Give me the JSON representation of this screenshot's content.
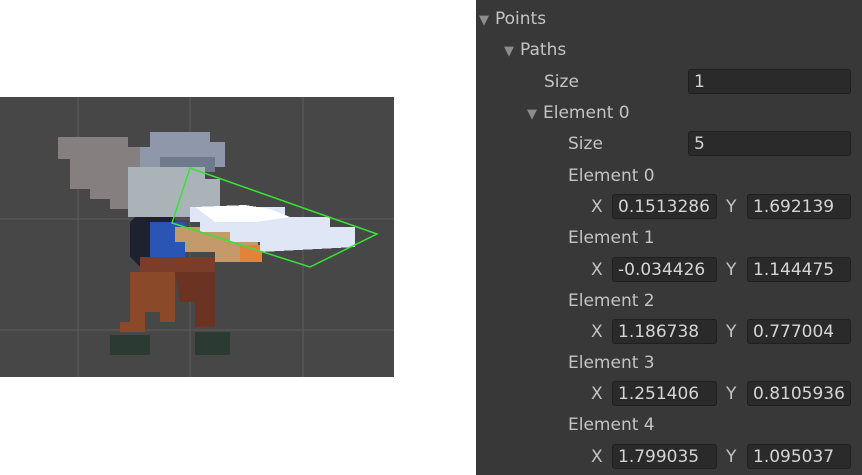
{
  "scene": {
    "background": "#474747",
    "grid_color": "#5c5c5c",
    "collider_color": "#37e337"
  },
  "inspector": {
    "points_label": "Points",
    "paths_label": "Paths",
    "paths_size_label": "Size",
    "paths_size_value": "1",
    "path_element_label": "Element 0",
    "points_size_label": "Size",
    "points_size_value": "5",
    "x_label": "X",
    "y_label": "Y",
    "elements": [
      {
        "label": "Element 0",
        "x": "0.1513286",
        "y": "1.692139"
      },
      {
        "label": "Element 1",
        "x": "-0.034426",
        "y": "1.144475"
      },
      {
        "label": "Element 2",
        "x": "1.186738",
        "y": "0.777004"
      },
      {
        "label": "Element 3",
        "x": "1.251406",
        "y": "0.8105936"
      },
      {
        "label": "Element 4",
        "x": "1.799035",
        "y": "1.095037"
      }
    ]
  }
}
